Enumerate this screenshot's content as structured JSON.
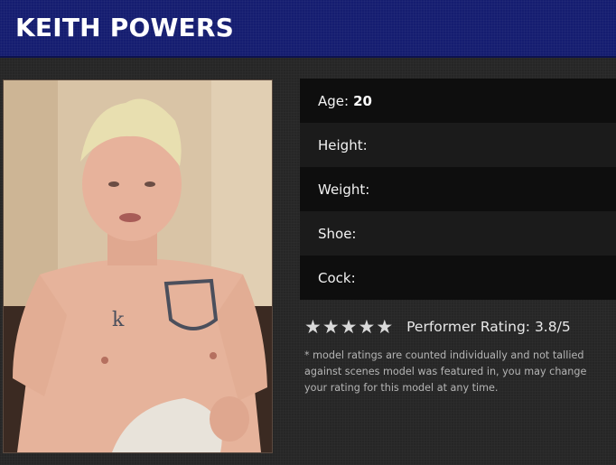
{
  "header": {
    "name": "KEITH POWERS"
  },
  "photo": {
    "description_icon": "model-photo"
  },
  "stats": {
    "age_label": "Age:",
    "age_value": "20",
    "height_label": "Height:",
    "weight_label": "Weight:",
    "shoe_label": "Shoe:",
    "cock_label": "Cock:"
  },
  "rating": {
    "stars": [
      "★",
      "★",
      "★",
      "★",
      "★"
    ],
    "text": "Performer Rating: 3.8/5",
    "value": 3.8,
    "max": 5
  },
  "note": "* model ratings are counted individually and not tallied against scenes model was featured in, you may change your rating for this model at any time.",
  "colors": {
    "header_bg": "#151d70",
    "page_bg": "#262626",
    "row_dark": "#0e0e0e",
    "row_light": "#1b1b1b",
    "star": "#d9d9d9"
  }
}
